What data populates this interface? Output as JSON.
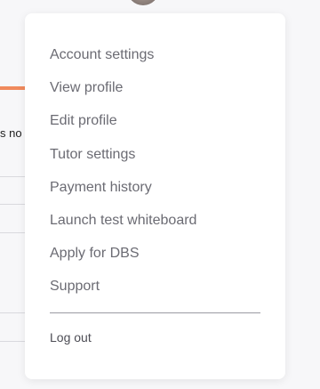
{
  "background": {
    "partial_text": "s no"
  },
  "menu": {
    "items": [
      {
        "label": "Account settings"
      },
      {
        "label": "View profile"
      },
      {
        "label": "Edit profile"
      },
      {
        "label": "Tutor settings"
      },
      {
        "label": "Payment history"
      },
      {
        "label": "Launch test whiteboard"
      },
      {
        "label": "Apply for DBS"
      },
      {
        "label": "Support"
      }
    ],
    "logout_label": "Log out"
  },
  "colors": {
    "accent": "#f08a5d",
    "menu_text": "#6b6b73",
    "logout_text": "#4d4d55"
  }
}
